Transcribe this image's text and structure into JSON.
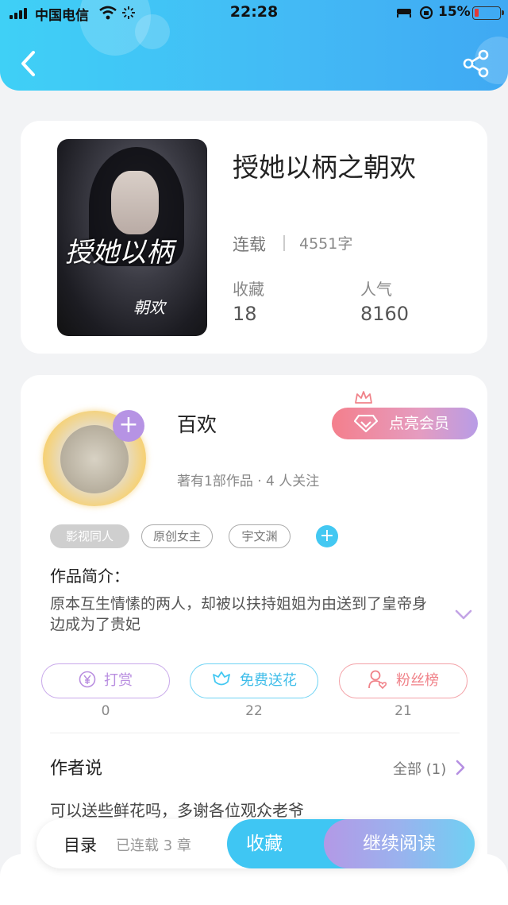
{
  "status_bar": {
    "carrier": "中国电信",
    "time": "22:28",
    "battery": "15%",
    "battery_level": 0.15
  },
  "header": {
    "back_icon": "chevron-left-icon",
    "share_icon": "share-icon",
    "gradient_start": "#3fd0f6",
    "gradient_end": "#3fa9f3"
  },
  "book": {
    "title": "授她以柄之朝欢",
    "cover_title": "授她以柄",
    "cover_subtitle": "朝欢",
    "status": "连载",
    "word_count": "4551字",
    "favorites_label": "收藏",
    "favorites_value": "18",
    "popularity_label": "人气",
    "popularity_value": "8160"
  },
  "author": {
    "name": "百欢",
    "vip_button": "点亮会员",
    "meta": "著有1部作品 · 4 人关注",
    "tags": [
      "影视同人",
      "原创女主",
      "宇文渊"
    ],
    "intro_label": "作品简介：",
    "intro_text": "原本互生情愫的两人，却被以扶持姐姐为由送到了皇帝身边成为了贵妃"
  },
  "actions": [
    {
      "label": "打赏",
      "count": "0",
      "icon": "yen-coin-icon",
      "color": "#b98ee0"
    },
    {
      "label": "免费送花",
      "count": "22",
      "icon": "flower-icon",
      "color": "#43c8f2"
    },
    {
      "label": "粉丝榜",
      "count": "21",
      "icon": "fan-user-icon",
      "color": "#f08289"
    }
  ],
  "author_says": {
    "title": "作者说",
    "all_link": "全部 (1)",
    "comment": "可以送些鲜花吗，多谢各位观众老爷"
  },
  "bottom_bar": {
    "toc": "目录",
    "chapters": "已连载 3 章",
    "collect": "收藏",
    "continue": "继续阅读"
  }
}
